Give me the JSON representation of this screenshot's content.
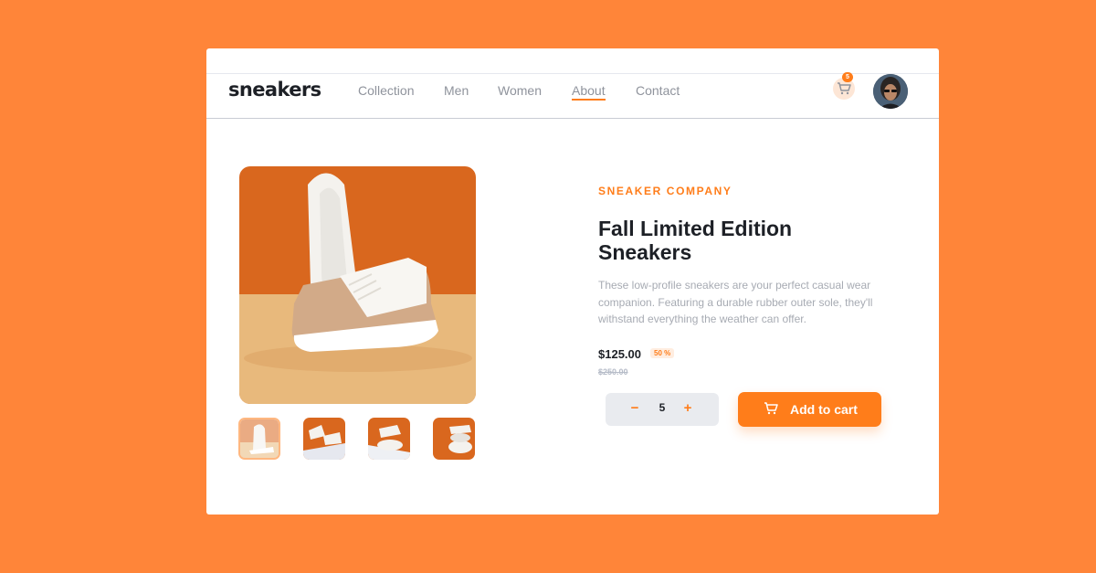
{
  "colors": {
    "background": "#ff8539",
    "accent": "#ff7d1a",
    "accent_light": "#ffede0",
    "dark_text": "#1d2026",
    "muted_text": "#a7abb3"
  },
  "header": {
    "logo": "sneakers",
    "nav": [
      "Collection",
      "Men",
      "Women",
      "About",
      "Contact"
    ],
    "active_nav": "About",
    "cart_icon": "cart-icon",
    "cart_count": "5",
    "avatar": "user-avatar"
  },
  "product": {
    "company": "SNEAKER COMPANY",
    "title": "Fall Limited Edition Sneakers",
    "description": "These low-profile sneakers are your perfect casual wear companion. Featuring a durable rubber outer sole, they'll withstand everything the weather can offer.",
    "price": "$125.00",
    "discount": "50 %",
    "old_price": "$250.00"
  },
  "cart_controls": {
    "minus": "−",
    "quantity": "5",
    "plus": "+",
    "add_label": "Add to cart"
  },
  "gallery": {
    "thumbnail_count": 4,
    "selected_index": 0
  }
}
